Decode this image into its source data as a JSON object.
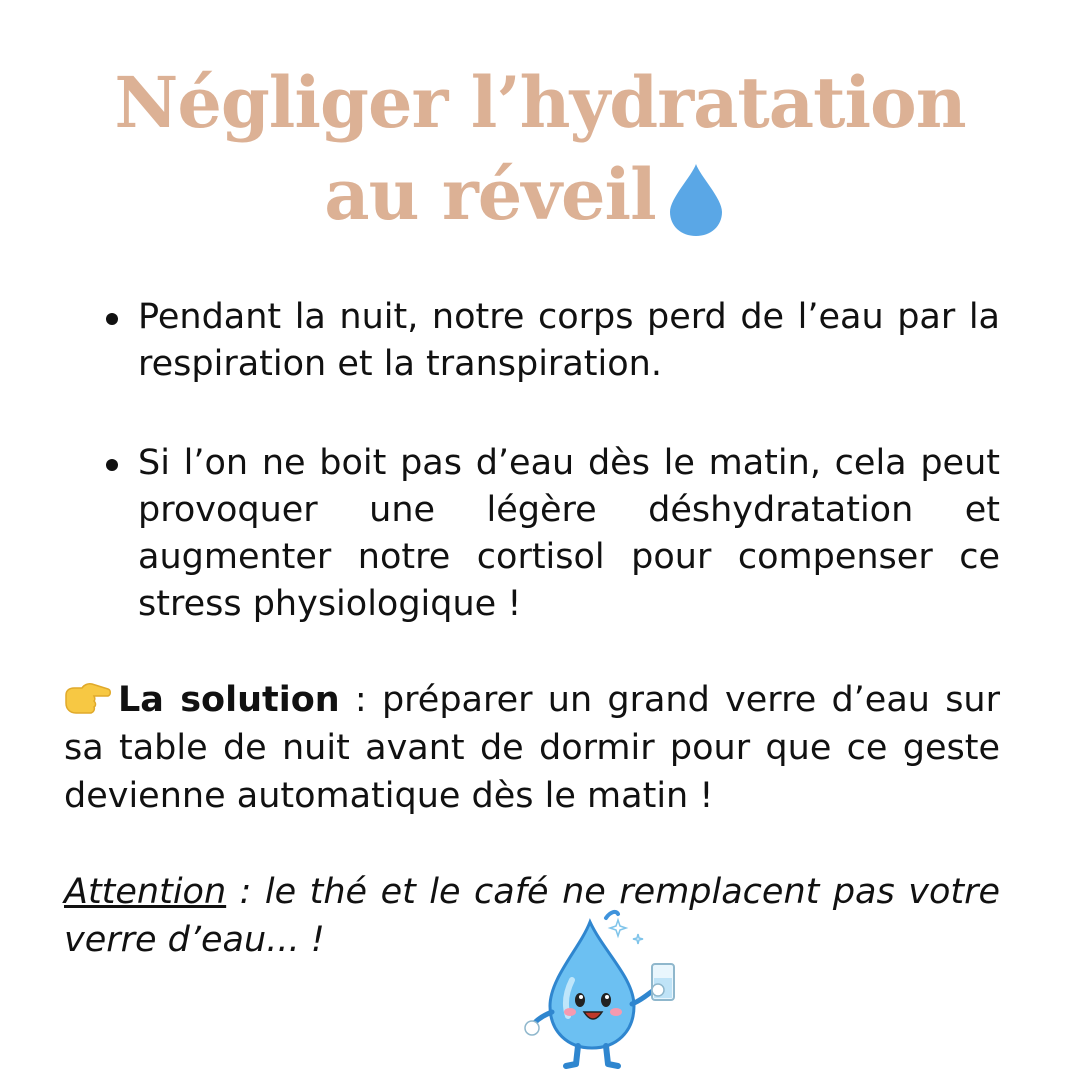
{
  "title": {
    "line1": "Négliger l’hydratation",
    "line2": "au réveil"
  },
  "bullets": [
    {
      "text": "Pendant la nuit, notre corps perd de l’eau par la respiration et la transpiration."
    },
    {
      "text": "Si l’on ne boit pas d’eau dès le matin, cela peut provoquer une légère déshydratation et augmenter notre cortisol pour compenser ce stress physiologique !"
    }
  ],
  "solution": {
    "label": "La solution",
    "text": " : préparer un grand verre d’eau sur sa table de nuit avant de dormir pour que ce geste devienne automatique dès le matin !"
  },
  "attention": {
    "label": "Attention",
    "text": " : le thé et le café ne remplacent pas votre verre d’eau... !"
  },
  "icons": {
    "title_icon": "water-drop-icon",
    "solution_icon": "pointing-hand-icon",
    "illustration": "water-drop-mascot-with-glass"
  },
  "colors": {
    "title": "#dcb195",
    "drop": "#5aa7e6",
    "text": "#111111",
    "hand": "#f7c843"
  }
}
